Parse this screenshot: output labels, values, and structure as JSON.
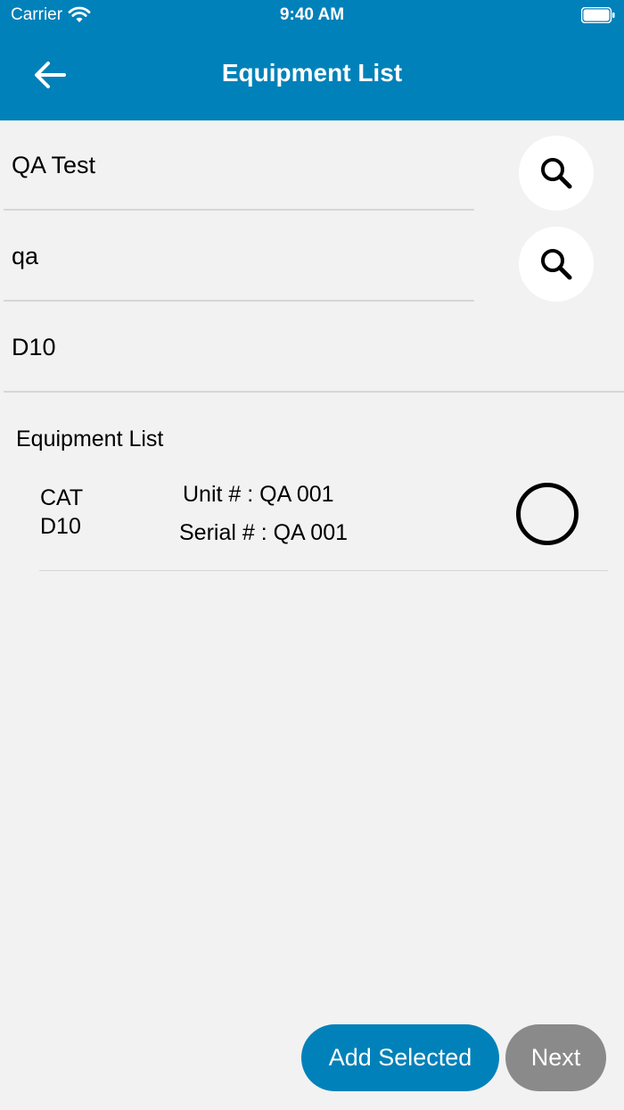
{
  "status_bar": {
    "carrier": "Carrier",
    "time": "9:40 AM"
  },
  "nav": {
    "title": "Equipment List"
  },
  "fields": [
    {
      "value": "QA Test",
      "has_search": true
    },
    {
      "value": "qa",
      "has_search": true
    },
    {
      "value": "D10",
      "has_search": false
    }
  ],
  "list": {
    "title": "Equipment List",
    "items": [
      {
        "make": "CAT",
        "model": "D10",
        "unit": "Unit # : QA 001",
        "serial": "Serial # : QA 001",
        "selected": false
      }
    ]
  },
  "buttons": {
    "add_selected": "Add Selected",
    "next": "Next"
  },
  "colors": {
    "primary": "#0181b9",
    "disabled": "#8a8a8a",
    "background": "#f2f2f2"
  }
}
